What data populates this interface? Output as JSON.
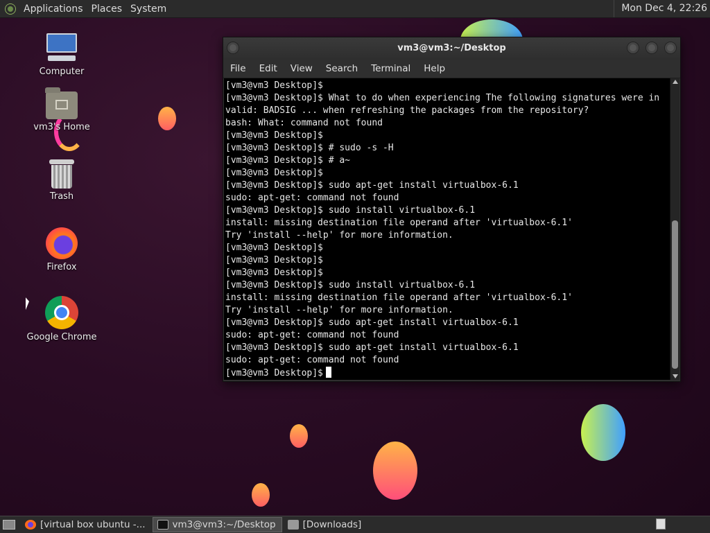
{
  "top_panel": {
    "menus": [
      "Applications",
      "Places",
      "System"
    ],
    "clock": "Mon Dec  4, 22:26"
  },
  "desktop": {
    "icons": [
      {
        "label": "Computer",
        "icon": "computer-icon"
      },
      {
        "label": "vm3's Home",
        "icon": "home-folder-icon"
      },
      {
        "label": "Trash",
        "icon": "trash-icon"
      },
      {
        "label": "Firefox",
        "icon": "firefox-icon"
      },
      {
        "label": "Google Chrome",
        "icon": "chrome-icon"
      }
    ]
  },
  "terminal": {
    "title": "vm3@vm3:~/Desktop",
    "menu": [
      "File",
      "Edit",
      "View",
      "Search",
      "Terminal",
      "Help"
    ],
    "lines": [
      "[vm3@vm3 Desktop]$",
      "[vm3@vm3 Desktop]$ What to do when experiencing The following signatures were in",
      "valid: BADSIG ... when refreshing the packages from the repository?",
      "bash: What: command not found",
      "[vm3@vm3 Desktop]$",
      "[vm3@vm3 Desktop]$ # sudo -s -H",
      "[vm3@vm3 Desktop]$ # a~",
      "[vm3@vm3 Desktop]$",
      "[vm3@vm3 Desktop]$ sudo apt-get install virtualbox-6.1",
      "sudo: apt-get: command not found",
      "[vm3@vm3 Desktop]$ sudo install virtualbox-6.1",
      "install: missing destination file operand after 'virtualbox-6.1'",
      "Try 'install --help' for more information.",
      "[vm3@vm3 Desktop]$",
      "[vm3@vm3 Desktop]$",
      "[vm3@vm3 Desktop]$",
      "[vm3@vm3 Desktop]$ sudo install virtualbox-6.1",
      "install: missing destination file operand after 'virtualbox-6.1'",
      "Try 'install --help' for more information.",
      "[vm3@vm3 Desktop]$ sudo apt-get install virtualbox-6.1",
      "sudo: apt-get: command not found",
      "[vm3@vm3 Desktop]$ sudo apt-get install virtualbox-6.1",
      "sudo: apt-get: command not found"
    ],
    "prompt": "[vm3@vm3 Desktop]$"
  },
  "taskbar": {
    "items": [
      {
        "label": "[virtual box ubuntu -...",
        "icon": "firefox-icon",
        "active": false
      },
      {
        "label": "vm3@vm3:~/Desktop",
        "icon": "terminal-icon",
        "active": true
      },
      {
        "label": "[Downloads]",
        "icon": "folder-icon",
        "active": false
      }
    ]
  }
}
